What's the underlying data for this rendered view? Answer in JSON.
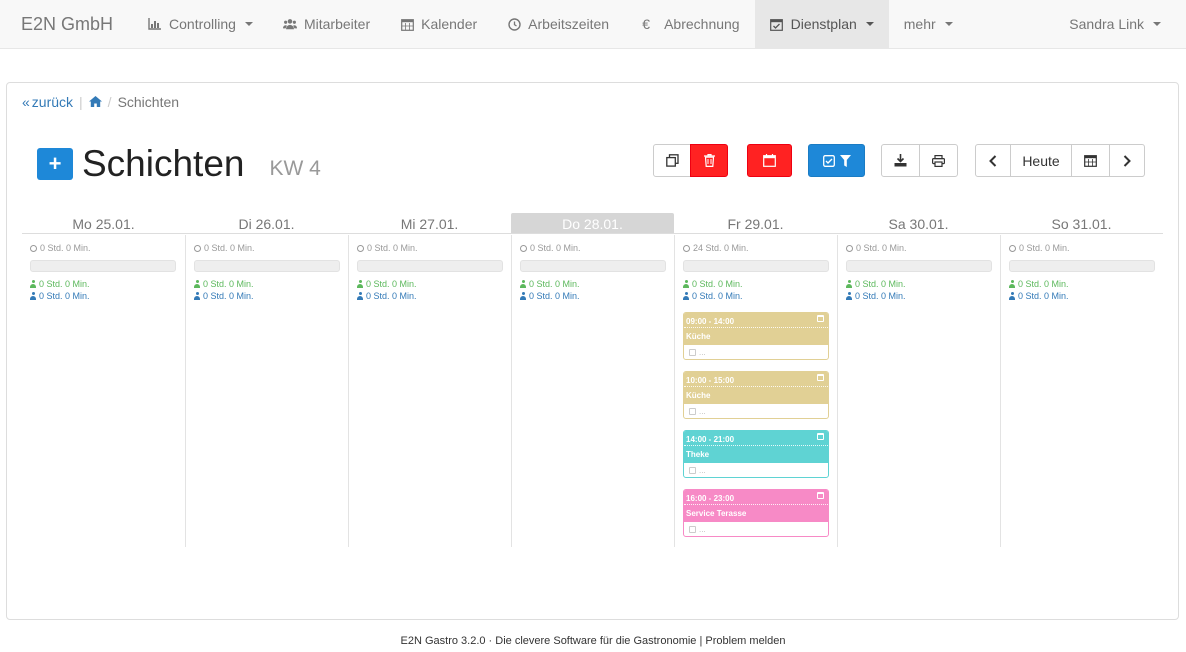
{
  "navbar": {
    "brand": "E2N GmbH",
    "items": [
      {
        "label": "Controlling",
        "icon": "bar-chart-icon",
        "dropdown": true
      },
      {
        "label": "Mitarbeiter",
        "icon": "users-icon"
      },
      {
        "label": "Kalender",
        "icon": "calendar-icon"
      },
      {
        "label": "Arbeitszeiten",
        "icon": "clock-icon"
      },
      {
        "label": "Abrechnung",
        "icon": "euro-icon"
      },
      {
        "label": "Dienstplan",
        "icon": "calendar-check-icon",
        "dropdown": true,
        "active": true
      },
      {
        "label": "mehr",
        "dropdown": true
      }
    ],
    "user": "Sandra Link"
  },
  "breadcrumb": {
    "back": "zurück",
    "current": "Schichten"
  },
  "header": {
    "title": "Schichten",
    "week": "KW 4"
  },
  "toolbar": {
    "today": "Heute"
  },
  "days": [
    {
      "label": "Mo 25.01.",
      "hours": "0 Std. 0 Min.",
      "green": "0 Std. 0 Min.",
      "blue": "0 Std. 0 Min."
    },
    {
      "label": "Di 26.01.",
      "hours": "0 Std. 0 Min.",
      "green": "0 Std. 0 Min.",
      "blue": "0 Std. 0 Min."
    },
    {
      "label": "Mi 27.01.",
      "hours": "0 Std. 0 Min.",
      "green": "0 Std. 0 Min.",
      "blue": "0 Std. 0 Min."
    },
    {
      "label": "Do 28.01.",
      "hours": "0 Std. 0 Min.",
      "green": "0 Std. 0 Min.",
      "blue": "0 Std. 0 Min.",
      "today": true
    },
    {
      "label": "Fr 29.01.",
      "hours": "24 Std. 0 Min.",
      "green": "0 Std. 0 Min.",
      "blue": "0 Std. 0 Min."
    },
    {
      "label": "Sa 30.01.",
      "hours": "0 Std. 0 Min.",
      "green": "0 Std. 0 Min.",
      "blue": "0 Std. 0 Min."
    },
    {
      "label": "So 31.01.",
      "hours": "0 Std. 0 Min.",
      "green": "0 Std. 0 Min.",
      "blue": "0 Std. 0 Min."
    }
  ],
  "shifts": [
    {
      "time": "09:00 - 14:00",
      "name": "Küche",
      "color": "#e1d095",
      "placeholder": "..."
    },
    {
      "time": "10:00 - 15:00",
      "name": "Küche",
      "color": "#e1d095",
      "placeholder": "..."
    },
    {
      "time": "14:00 - 21:00",
      "name": "Theke",
      "color": "#5fd3d3",
      "placeholder": "..."
    },
    {
      "time": "16:00 - 23:00",
      "name": "Service Terasse",
      "color": "#f78ac6",
      "placeholder": "..."
    }
  ],
  "footer": {
    "text": "E2N Gastro 3.2.0 · Die clevere Software für die Gastronomie | Problem melden"
  },
  "colors": {
    "accent": "#1e88d8",
    "danger": "#ff2222"
  }
}
